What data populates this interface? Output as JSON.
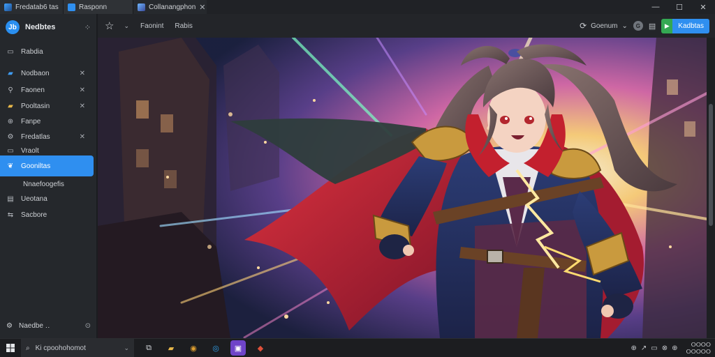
{
  "tabs": [
    {
      "title": "Fredatab6 tas",
      "icon": "app-icon",
      "closable": false
    },
    {
      "title": "Rasponn",
      "icon": "blue-app-icon",
      "closable": false
    },
    {
      "title": "Collanangphon",
      "icon": "photo-app-icon",
      "closable": true,
      "close_glyph": "✕"
    }
  ],
  "window_controls": {
    "minimize": "—",
    "maximize": "☐",
    "close": "✕"
  },
  "sidebar": {
    "logo_text": "Jb",
    "title": "Nedbtes",
    "grid_glyph": "⁘",
    "items": [
      {
        "label": "Rabdia",
        "icon": "window-icon",
        "glyph": "▭",
        "close": ""
      },
      {
        "label": "Nodbaon",
        "icon": "blue-folder-icon",
        "glyph": "▰",
        "close": "✕"
      },
      {
        "label": "Faonen",
        "icon": "pin-icon",
        "glyph": "⚲",
        "close": "✕"
      },
      {
        "label": "Pooltasin",
        "icon": "yellow-folder-icon",
        "glyph": "▰",
        "close": "✕"
      },
      {
        "label": "Fanpe",
        "icon": "globe-icon",
        "glyph": "⊕",
        "close": ""
      },
      {
        "label": "Fredatlas",
        "icon": "settings-icon",
        "glyph": "⚙",
        "close": "✕"
      },
      {
        "label": "Vraolt",
        "icon": "monitor-icon",
        "glyph": "▭",
        "close": ""
      },
      {
        "label": "Gooniltas",
        "icon": "leaf-icon",
        "glyph": "❦",
        "close": ""
      },
      {
        "label": "Nnaefoogefis",
        "icon": "",
        "glyph": "",
        "close": ""
      },
      {
        "label": "Ueotana",
        "icon": "document-icon",
        "glyph": "▤",
        "close": ""
      },
      {
        "label": "Sacbore",
        "icon": "share-icon",
        "glyph": "⇆",
        "close": ""
      }
    ],
    "footer": {
      "label": "Naedbe ‥",
      "icon": "gear-icon",
      "glyph": "⚙",
      "right_glyph": "⊙"
    }
  },
  "toolbar": {
    "star_glyph": "☆",
    "chevron_glyph": "⌄",
    "links": [
      "Faonint",
      "Rabis"
    ],
    "account_label": "Goenum",
    "account_glyph": "⟳",
    "account_chevron": "⌄",
    "avatar_text": "G",
    "doc_glyph": "▤",
    "cta_label": "Kadbtas",
    "cta_glyph": "▶"
  },
  "taskbar": {
    "search_text": "Ki cpoohohomot",
    "search_glyph": "⌕",
    "chevron": "⌄",
    "apps": [
      {
        "name": "task-view-icon",
        "glyph": "⧉",
        "bg": "#1c1d20",
        "fg": "#d6d9dd"
      },
      {
        "name": "file-explorer-icon",
        "glyph": "▰",
        "bg": "#1c1d20",
        "fg": "#e8b84a"
      },
      {
        "name": "chrome-icon",
        "glyph": "◉",
        "bg": "#1c1d20",
        "fg": "#e0a030"
      },
      {
        "name": "edge-icon",
        "glyph": "◎",
        "bg": "#1c1d20",
        "fg": "#2f9fe8"
      },
      {
        "name": "twitch-icon",
        "glyph": "▣",
        "bg": "#6f44c8",
        "fg": "#ffffff"
      },
      {
        "name": "brave-icon",
        "glyph": "◆",
        "bg": "#1c1d20",
        "fg": "#e0503a"
      }
    ],
    "tray": [
      "⊕",
      "↗",
      "▭",
      "⊗",
      "⊕"
    ],
    "time": "ⵔⵔⵔⵔ",
    "date": "ⵔⵔⵔⵔⵔ"
  },
  "colors": {
    "accent": "#2f8ff0",
    "cta_green": "#34a853",
    "sidebar_bg": "#25282c",
    "toolbar_bg": "#232529"
  }
}
